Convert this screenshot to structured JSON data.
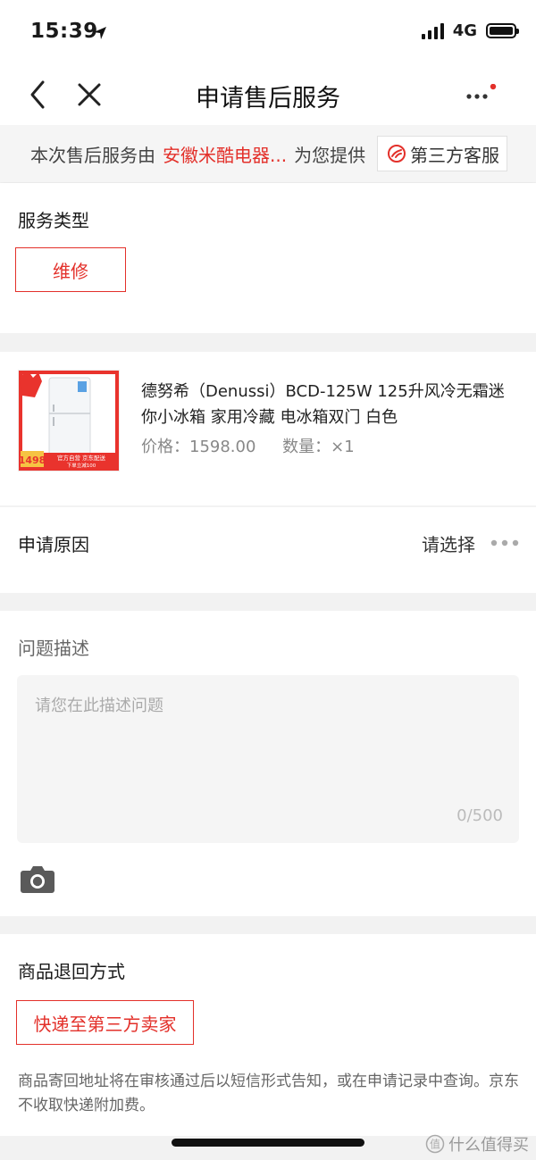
{
  "status_bar": {
    "time": "15:39",
    "network": "4G"
  },
  "nav": {
    "title": "申请售后服务"
  },
  "notice": {
    "prefix": "本次售后服务由",
    "store": "安徽米酷电器...",
    "suffix": "为您提供",
    "button_label": "第三方客服"
  },
  "service": {
    "label": "服务类型",
    "selected": "维修"
  },
  "product": {
    "title": "德努希（Denussi）BCD-125W 125升风冷无霜迷你小冰箱 家用冷藏 电冰箱双门 白色",
    "price_label": "价格：",
    "price": "1598.00",
    "qty_label": "数量：",
    "qty": "×1",
    "image_badge_price": "1498",
    "image_badge_text": "官方自营 京东配送",
    "image_badge_sub": "下单立减100"
  },
  "reason": {
    "label": "申请原因",
    "value": "请选择"
  },
  "description": {
    "label": "问题描述",
    "placeholder": "请您在此描述问题",
    "counter": "0/500"
  },
  "return_method": {
    "label": "商品退回方式",
    "selected": "快递至第三方卖家",
    "note": "商品寄回地址将在审核通过后以短信形式告知，或在申请记录中查询。京东不收取快递附加费。"
  },
  "watermark": {
    "text": "什么值得买"
  },
  "colors": {
    "accent": "#e3302a",
    "background": "#f2f2f2",
    "card": "#ffffff"
  }
}
